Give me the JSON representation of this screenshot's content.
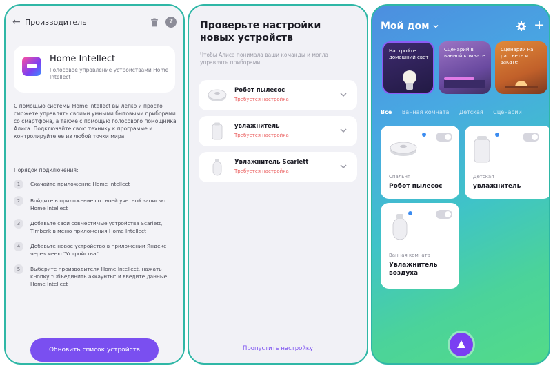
{
  "screen1": {
    "title": "Производитель",
    "brand": {
      "name": "Home Intellect",
      "description": "Голосовое управление устройствами Home Intellect"
    },
    "intro": "С помощью системы Home Intellect вы легко и просто сможете управлять своими умными бытовыми приборами со смартфона, а также с помощью голосового помощника Алиса. Подключайте свою технику к программе и контролируйте ее из любой точки мира.",
    "order_title": "Порядок подключения:",
    "steps": [
      {
        "num": "1",
        "text": "Скачайте приложение Home Intellect"
      },
      {
        "num": "2",
        "text": "Войдите в приложение со своей учетной записью Home Intellect"
      },
      {
        "num": "3",
        "text": "Добавьте свои совместимые устройства Scarlett, Timberk в меню приложения Home Intellect"
      },
      {
        "num": "4",
        "text": "Добавьте новое устройство в приложении Яндекс через меню \"Устройства\""
      },
      {
        "num": "5",
        "text": "Выберите производителя Home Intellect, нажать кнопку \"Объединить аккаунты\" и введите данные Home Intellect"
      }
    ],
    "refresh_button": "Обновить список устройств",
    "colors": {
      "accent": "#7a4ff0",
      "frame": "#2fb7a6"
    }
  },
  "screen2": {
    "title": "Проверьте настройки новых устройств",
    "subtitle": "Чтобы Алиса понимала ваши команды и могла управлять приборами",
    "devices": [
      {
        "name": "Робот пылесос",
        "status": "Требуется настройка",
        "icon": "robot-vacuum-icon"
      },
      {
        "name": "увлажнитель",
        "status": "Требуется настройка",
        "icon": "humidifier-icon"
      },
      {
        "name": "Увлажнитель Scarlett",
        "status": "Требуется настройка",
        "icon": "humidifier-icon"
      }
    ],
    "skip_link": "Пропустить настройку",
    "colors": {
      "warning": "#ea5a5a"
    }
  },
  "screen3": {
    "home_title": "Мой дом",
    "stories": [
      {
        "label": "Настройте домашний свет"
      },
      {
        "label": "Сценарий в ванной комнате"
      },
      {
        "label": "Сценарии на рассвете и закате"
      }
    ],
    "tabs": [
      {
        "label": "Все",
        "active": true
      },
      {
        "label": "Ванная комната",
        "active": false
      },
      {
        "label": "Детская",
        "active": false
      },
      {
        "label": "Сценарии",
        "active": false
      }
    ],
    "devices": [
      {
        "room": "Спальня",
        "name": "Робот пылесос",
        "icon": "robot-vacuum-icon"
      },
      {
        "room": "Детская",
        "name": "увлажнитель",
        "icon": "humidifier-icon"
      },
      {
        "room": "Ванная комната",
        "name": "Увлажнитель воздуха",
        "icon": "humidifier-icon"
      }
    ],
    "colors": {
      "alice": "#7a3ff2"
    }
  }
}
